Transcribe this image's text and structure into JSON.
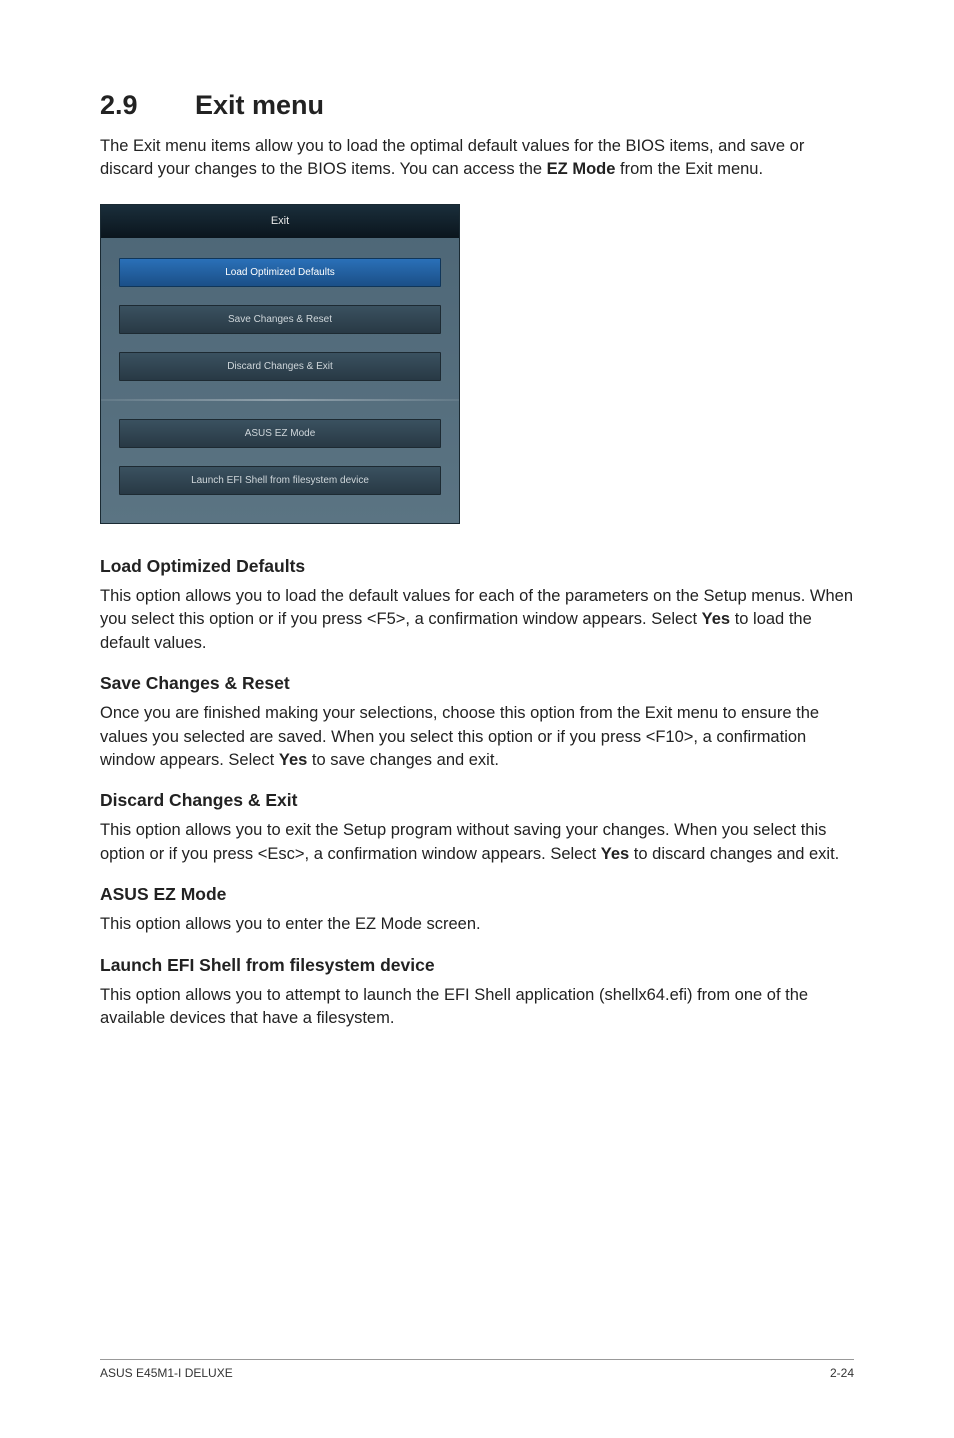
{
  "header": {
    "section_number": "2.9",
    "section_title": "Exit menu",
    "intro_a": "The Exit menu items allow you to load the optimal default values for the BIOS items, and save or discard your changes to the BIOS items. You can access the ",
    "intro_bold": "EZ Mode",
    "intro_b": " from the Exit menu."
  },
  "exit_dialog": {
    "title": "Exit",
    "items": [
      {
        "label": "Load Optimized Defaults",
        "selected": true
      },
      {
        "label": "Save Changes & Reset",
        "selected": false
      },
      {
        "label": "Discard Changes & Exit",
        "selected": false
      }
    ],
    "items2": [
      {
        "label": "ASUS EZ Mode",
        "selected": false
      },
      {
        "label": "Launch EFI Shell from filesystem device",
        "selected": false
      }
    ]
  },
  "sections": {
    "s1": {
      "title": "Load Optimized Defaults",
      "p_a": "This option allows you to load the default values for each of the parameters on the Setup menus. When you select this option or if you press <F5>, a confirmation window appears. Select ",
      "p_bold": "Yes",
      "p_b": " to load the default values."
    },
    "s2": {
      "title": "Save Changes & Reset",
      "p_a": "Once you are finished making your selections, choose this option from the Exit menu to ensure the values you selected are saved. When you select this option or if you press <F10>, a confirmation window appears. Select ",
      "p_bold": "Yes",
      "p_b": " to save changes and exit."
    },
    "s3": {
      "title": "Discard Changes & Exit",
      "p_a": "This option allows you to exit the Setup program without saving your changes. When you select this option or if you press <Esc>, a confirmation window appears. Select ",
      "p_bold": "Yes",
      "p_b": " to discard changes and exit."
    },
    "s4": {
      "title": "ASUS EZ Mode",
      "p": "This option allows you to enter the EZ Mode screen."
    },
    "s5": {
      "title": "Launch EFI Shell from filesystem device",
      "p": "This option allows you to attempt to launch the EFI Shell application (shellx64.efi) from one of the available devices that have a filesystem."
    }
  },
  "footer": {
    "left": "ASUS E45M1-I DELUXE",
    "right": "2-24"
  }
}
